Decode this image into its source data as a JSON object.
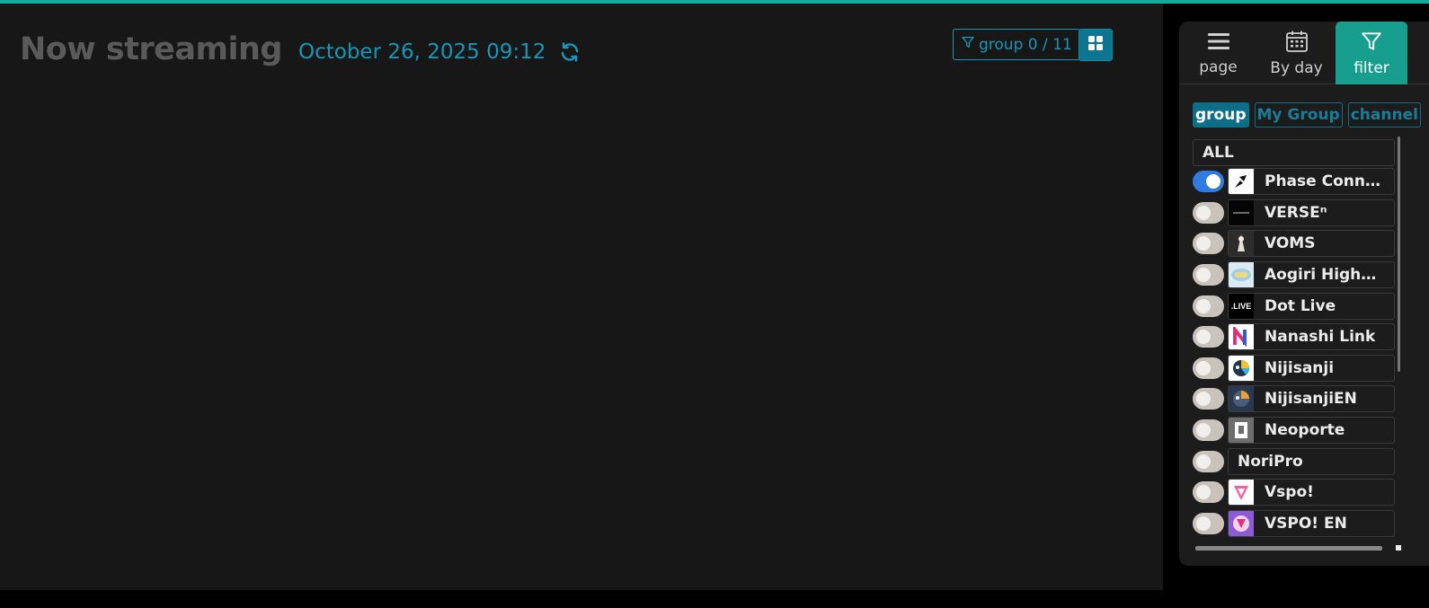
{
  "colors": {
    "accent_teal": "#13a99d",
    "accent_blue": "#1497b8",
    "filter_tab_bg": "#179e8e",
    "toggle_on": "#2f7be2",
    "toggle_off": "#c9c3bb"
  },
  "main": {
    "title": "Now streaming",
    "datetime": "October 26, 2025 09:12",
    "refresh_icon": "refresh-icon",
    "group_filter_label": "group 0 / 11",
    "view_modes": [
      {
        "name": "grid",
        "icon": "grid-icon",
        "active": false
      },
      {
        "name": "list",
        "icon": "list-icon",
        "active": true
      }
    ]
  },
  "sidebar": {
    "tabs": [
      {
        "label": "page",
        "icon": "menu-icon",
        "active": false
      },
      {
        "label": "By day",
        "icon": "calendar-icon",
        "active": false
      },
      {
        "label": "filter",
        "icon": "filter-icon",
        "active": true
      }
    ],
    "subtabs": [
      {
        "label": "group",
        "active": true
      },
      {
        "label": "My Group",
        "active": false
      },
      {
        "label": "channel",
        "active": false
      }
    ],
    "all_label": "ALL",
    "groups": [
      {
        "label": "Phase Connect",
        "on": true,
        "logo": "phase-connect-logo"
      },
      {
        "label": "VERSEⁿ",
        "on": false,
        "logo": "verse-logo"
      },
      {
        "label": "VOMS",
        "on": false,
        "logo": "voms-logo"
      },
      {
        "label": "Aogiri High…",
        "on": false,
        "logo": "aogiri-logo"
      },
      {
        "label": "Dot Live",
        "on": false,
        "logo": "dot-live-logo"
      },
      {
        "label": "Nanashi Link",
        "on": false,
        "logo": "nanashi-link-logo"
      },
      {
        "label": "Nijisanji",
        "on": false,
        "logo": "nijisanji-logo"
      },
      {
        "label": "NijisanjiEN",
        "on": false,
        "logo": "nijisanji-en-logo"
      },
      {
        "label": "Neoporte",
        "on": false,
        "logo": "neoporte-logo"
      },
      {
        "label": "NoriPro",
        "on": false,
        "logo": ""
      },
      {
        "label": "Vspo!",
        "on": false,
        "logo": "vspo-logo"
      },
      {
        "label": "VSPO! EN",
        "on": false,
        "logo": "vspo-en-logo"
      }
    ]
  }
}
